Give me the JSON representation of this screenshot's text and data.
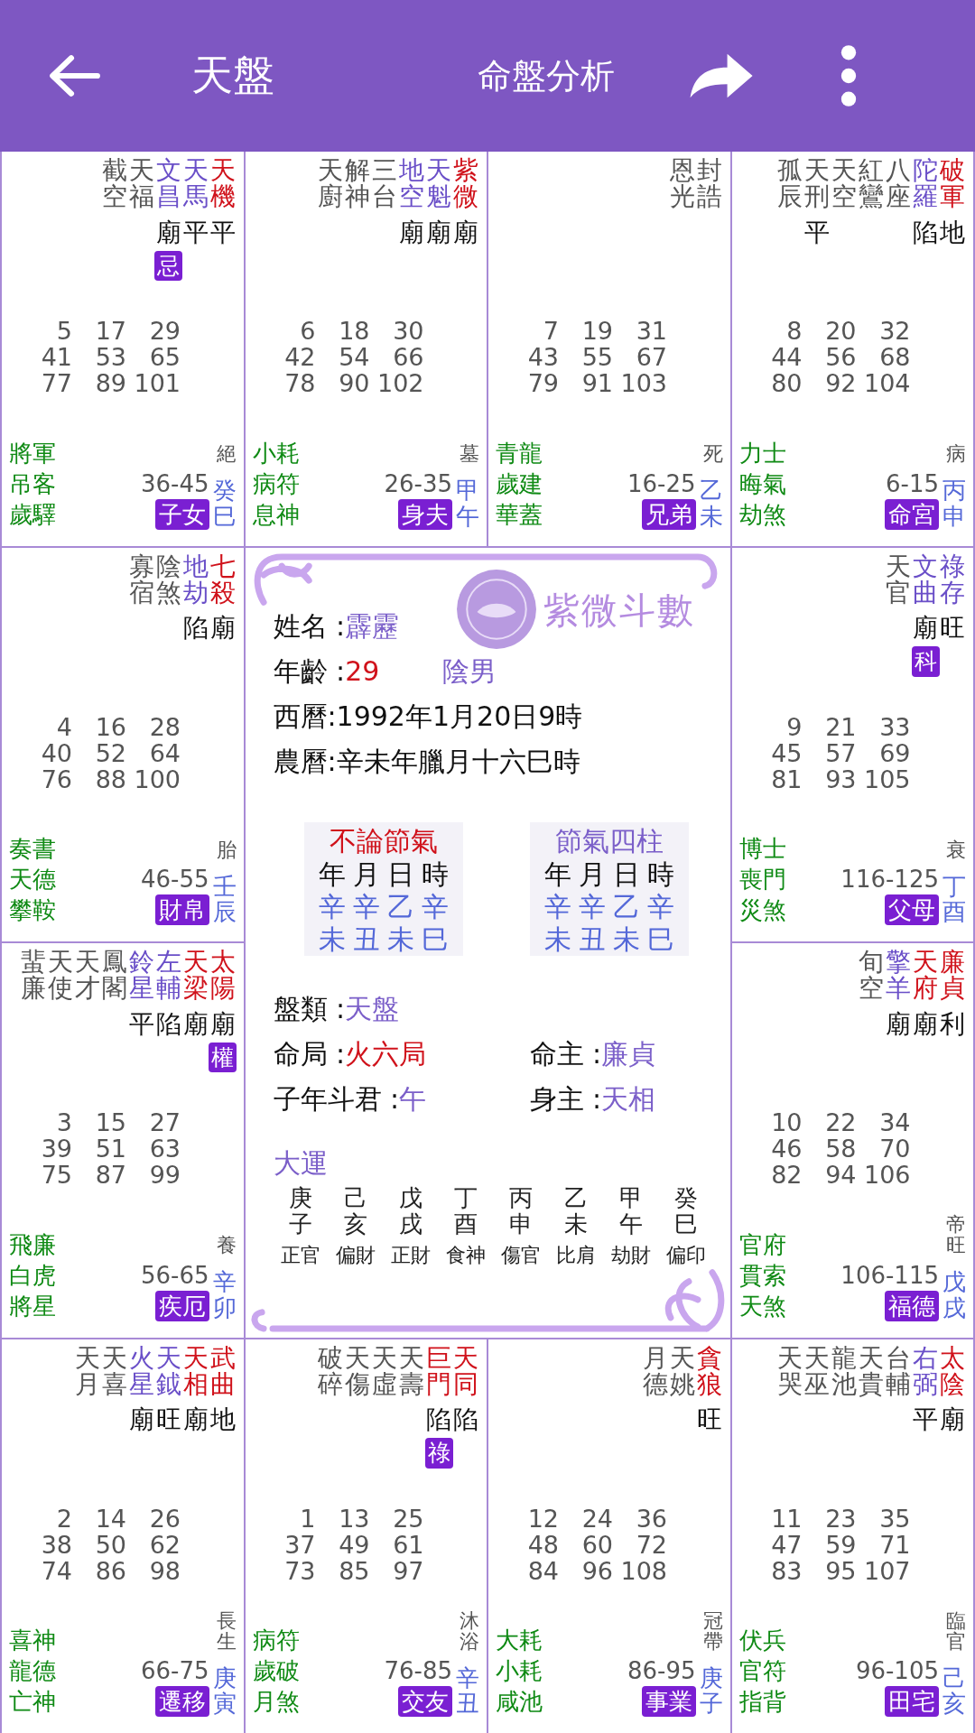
{
  "header": {
    "title": "天盤",
    "action": "命盤分析"
  },
  "palaces": [
    {
      "stars": [
        {
          "name": "截空",
          "kind": "minor"
        },
        {
          "name": "天福",
          "kind": "minor"
        },
        {
          "name": "文昌",
          "kind": "aux",
          "brightness": "廟",
          "hua": "忌"
        },
        {
          "name": "天馬",
          "kind": "aux",
          "brightness": "平"
        },
        {
          "name": "天機",
          "kind": "major",
          "brightness": "平"
        }
      ],
      "ages": [
        "5",
        "17",
        "29",
        "41",
        "53",
        "65",
        "77",
        "89",
        "101"
      ],
      "gods": [
        "將軍",
        "吊客",
        "歲驛"
      ],
      "stage": "絕",
      "decade": "36-45",
      "palace": "子女",
      "ganzhi": "癸巳"
    },
    {
      "stars": [
        {
          "name": "天廚",
          "kind": "minor"
        },
        {
          "name": "解神",
          "kind": "minor"
        },
        {
          "name": "三台",
          "kind": "minor"
        },
        {
          "name": "地空",
          "kind": "aux",
          "brightness": "廟"
        },
        {
          "name": "天魁",
          "kind": "aux",
          "brightness": "廟"
        },
        {
          "name": "紫微",
          "kind": "major",
          "brightness": "廟"
        }
      ],
      "ages": [
        "6",
        "18",
        "30",
        "42",
        "54",
        "66",
        "78",
        "90",
        "102"
      ],
      "gods": [
        "小耗",
        "病符",
        "息神"
      ],
      "stage": "墓",
      "decade": "26-35",
      "palace": "身夫",
      "ganzhi": "甲午"
    },
    {
      "stars": [
        {
          "name": "恩光",
          "kind": "minor"
        },
        {
          "name": "封誥",
          "kind": "minor"
        }
      ],
      "ages": [
        "7",
        "19",
        "31",
        "43",
        "55",
        "67",
        "79",
        "91",
        "103"
      ],
      "gods": [
        "青龍",
        "歲建",
        "華蓋"
      ],
      "stage": "死",
      "decade": "16-25",
      "palace": "兄弟",
      "ganzhi": "乙未"
    },
    {
      "stars": [
        {
          "name": "孤辰",
          "kind": "minor"
        },
        {
          "name": "天刑",
          "kind": "minor",
          "brightness": "平"
        },
        {
          "name": "天空",
          "kind": "minor"
        },
        {
          "name": "紅鸞",
          "kind": "minor"
        },
        {
          "name": "八座",
          "kind": "minor"
        },
        {
          "name": "陀羅",
          "kind": "aux",
          "brightness": "陷"
        },
        {
          "name": "破軍",
          "kind": "major",
          "brightness": "地"
        }
      ],
      "ages": [
        "8",
        "20",
        "32",
        "44",
        "56",
        "68",
        "80",
        "92",
        "104"
      ],
      "gods": [
        "力士",
        "晦氣",
        "劫煞"
      ],
      "stage": "病",
      "decade": "6-15",
      "palace": "命宮",
      "ganzhi": "丙申"
    },
    {
      "stars": [
        {
          "name": "寡宿",
          "kind": "minor"
        },
        {
          "name": "陰煞",
          "kind": "minor"
        },
        {
          "name": "地劫",
          "kind": "aux",
          "brightness": "陷"
        },
        {
          "name": "七殺",
          "kind": "major",
          "brightness": "廟"
        }
      ],
      "ages": [
        "4",
        "16",
        "28",
        "40",
        "52",
        "64",
        "76",
        "88",
        "100"
      ],
      "gods": [
        "奏書",
        "天德",
        "攀鞍"
      ],
      "stage": "胎",
      "decade": "46-55",
      "palace": "財帛",
      "ganzhi": "壬辰"
    },
    {
      "stars": [
        {
          "name": "天官",
          "kind": "minor"
        },
        {
          "name": "文曲",
          "kind": "aux",
          "brightness": "廟",
          "hua": "科"
        },
        {
          "name": "祿存",
          "kind": "aux",
          "brightness": "旺"
        }
      ],
      "ages": [
        "9",
        "21",
        "33",
        "45",
        "57",
        "69",
        "81",
        "93",
        "105"
      ],
      "gods": [
        "博士",
        "喪門",
        "災煞"
      ],
      "stage": "衰",
      "decade": "116-125",
      "palace": "父母",
      "ganzhi": "丁酉"
    },
    {
      "stars": [
        {
          "name": "蜚廉",
          "kind": "minor"
        },
        {
          "name": "天使",
          "kind": "minor"
        },
        {
          "name": "天才",
          "kind": "minor"
        },
        {
          "name": "鳳閣",
          "kind": "minor"
        },
        {
          "name": "鈴星",
          "kind": "aux",
          "brightness": "平"
        },
        {
          "name": "左輔",
          "kind": "aux",
          "brightness": "陷"
        },
        {
          "name": "天梁",
          "kind": "major",
          "brightness": "廟"
        },
        {
          "name": "太陽",
          "kind": "major",
          "brightness": "廟",
          "hua": "權"
        }
      ],
      "ages": [
        "3",
        "15",
        "27",
        "39",
        "51",
        "63",
        "75",
        "87",
        "99"
      ],
      "gods": [
        "飛廉",
        "白虎",
        "將星"
      ],
      "stage": "養",
      "decade": "56-65",
      "palace": "疾厄",
      "ganzhi": "辛卯"
    },
    {
      "stars": [
        {
          "name": "旬空",
          "kind": "minor"
        },
        {
          "name": "擎羊",
          "kind": "aux",
          "brightness": "廟"
        },
        {
          "name": "天府",
          "kind": "major",
          "brightness": "廟"
        },
        {
          "name": "廉貞",
          "kind": "major",
          "brightness": "利"
        }
      ],
      "ages": [
        "10",
        "22",
        "34",
        "46",
        "58",
        "70",
        "82",
        "94",
        "106"
      ],
      "gods": [
        "官府",
        "貫索",
        "天煞"
      ],
      "stage": "帝旺",
      "decade": "106-115",
      "palace": "福德",
      "ganzhi": "戊戌"
    },
    {
      "stars": [
        {
          "name": "天月",
          "kind": "minor"
        },
        {
          "name": "天喜",
          "kind": "minor"
        },
        {
          "name": "火星",
          "kind": "aux",
          "brightness": "廟"
        },
        {
          "name": "天鉞",
          "kind": "aux",
          "brightness": "旺"
        },
        {
          "name": "天相",
          "kind": "major",
          "brightness": "廟"
        },
        {
          "name": "武曲",
          "kind": "major",
          "brightness": "地"
        }
      ],
      "ages": [
        "2",
        "14",
        "26",
        "38",
        "50",
        "62",
        "74",
        "86",
        "98"
      ],
      "gods": [
        "喜神",
        "龍德",
        "亡神"
      ],
      "stage": "長生",
      "decade": "66-75",
      "palace": "遷移",
      "ganzhi": "庚寅"
    },
    {
      "stars": [
        {
          "name": "破碎",
          "kind": "minor"
        },
        {
          "name": "天傷",
          "kind": "minor"
        },
        {
          "name": "天虛",
          "kind": "minor"
        },
        {
          "name": "天壽",
          "kind": "minor"
        },
        {
          "name": "巨門",
          "kind": "major",
          "brightness": "陷",
          "hua": "祿"
        },
        {
          "name": "天同",
          "kind": "major",
          "brightness": "陷"
        }
      ],
      "ages": [
        "1",
        "13",
        "25",
        "37",
        "49",
        "61",
        "73",
        "85",
        "97"
      ],
      "gods": [
        "病符",
        "歲破",
        "月煞"
      ],
      "stage": "沐浴",
      "decade": "76-85",
      "palace": "交友",
      "ganzhi": "辛丑"
    },
    {
      "stars": [
        {
          "name": "月德",
          "kind": "minor"
        },
        {
          "name": "天姚",
          "kind": "minor"
        },
        {
          "name": "貪狼",
          "kind": "major",
          "brightness": "旺"
        }
      ],
      "ages": [
        "12",
        "24",
        "36",
        "48",
        "60",
        "72",
        "84",
        "96",
        "108"
      ],
      "gods": [
        "大耗",
        "小耗",
        "咸池"
      ],
      "stage": "冠帶",
      "decade": "86-95",
      "palace": "事業",
      "ganzhi": "庚子"
    },
    {
      "stars": [
        {
          "name": "天哭",
          "kind": "minor"
        },
        {
          "name": "天巫",
          "kind": "minor"
        },
        {
          "name": "龍池",
          "kind": "minor"
        },
        {
          "name": "天貴",
          "kind": "minor"
        },
        {
          "name": "台輔",
          "kind": "minor"
        },
        {
          "name": "右弼",
          "kind": "aux",
          "brightness": "平"
        },
        {
          "name": "太陰",
          "kind": "major",
          "brightness": "廟"
        }
      ],
      "ages": [
        "11",
        "23",
        "35",
        "47",
        "59",
        "71",
        "83",
        "95",
        "107"
      ],
      "gods": [
        "伏兵",
        "官符",
        "指背"
      ],
      "stage": "臨官",
      "decade": "96-105",
      "palace": "田宅",
      "ganzhi": "己亥"
    }
  ],
  "center": {
    "logo": "紫微斗數",
    "name_label": "姓名 :",
    "name": "霹靂",
    "age_label": "年齡 :",
    "age": "29",
    "gender": "陰男",
    "solar": "西曆:1992年1月20日9時",
    "lunar": "農曆:辛未年臘月十六巳時",
    "pillars": [
      {
        "title": "不論節氣",
        "color": "#d0121b",
        "headers": [
          "年",
          "月",
          "日",
          "時"
        ],
        "stems": [
          "辛",
          "辛",
          "乙",
          "辛"
        ],
        "branches": [
          "未",
          "丑",
          "未",
          "巳"
        ]
      },
      {
        "title": "節氣四柱",
        "color": "#7b5fc9",
        "headers": [
          "年",
          "月",
          "日",
          "時"
        ],
        "stems": [
          "辛",
          "辛",
          "乙",
          "辛"
        ],
        "branches": [
          "未",
          "丑",
          "未",
          "巳"
        ]
      }
    ],
    "fields": [
      [
        {
          "label": "盤類 :",
          "value": "天盤",
          "color": "#7b5fc9"
        }
      ],
      [
        {
          "label": "命局 :",
          "value": "火六局",
          "color": "#d0121b"
        },
        {
          "label": "命主 :",
          "value": "廉貞",
          "color": "#7b5fc9"
        }
      ],
      [
        {
          "label": "子年斗君 :",
          "value": "午",
          "color": "#7b5fc9"
        },
        {
          "label": "身主 :",
          "value": "天相",
          "color": "#7b5fc9"
        }
      ]
    ],
    "dayun_label": "大運",
    "dayun": [
      {
        "stem": "庚",
        "branch": "子",
        "god": "正官"
      },
      {
        "stem": "己",
        "branch": "亥",
        "god": "偏財"
      },
      {
        "stem": "戊",
        "branch": "戌",
        "god": "正財"
      },
      {
        "stem": "丁",
        "branch": "酉",
        "god": "食神"
      },
      {
        "stem": "丙",
        "branch": "申",
        "god": "傷官"
      },
      {
        "stem": "乙",
        "branch": "未",
        "god": "比肩"
      },
      {
        "stem": "甲",
        "branch": "午",
        "god": "劫財"
      },
      {
        "stem": "癸",
        "branch": "巳",
        "god": "偏印"
      }
    ]
  }
}
